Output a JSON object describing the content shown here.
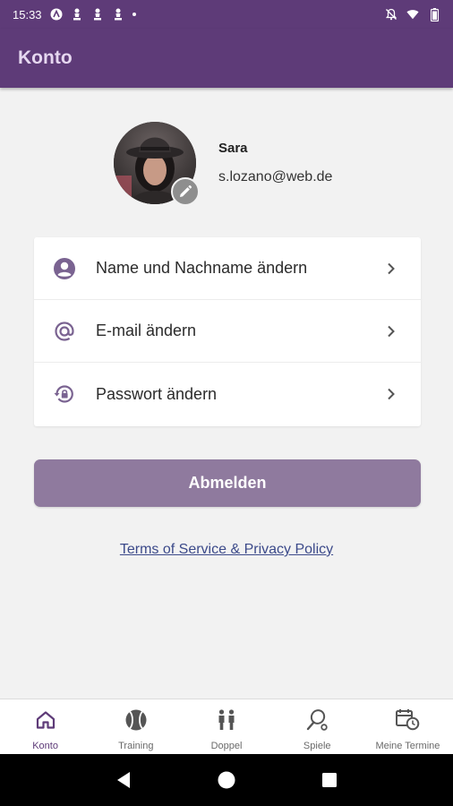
{
  "status_bar": {
    "time": "15:33",
    "icons_left": [
      "accessibility-icon",
      "chess-pawn-icon",
      "chess-pawn-icon",
      "chess-pawn-icon",
      "dot"
    ],
    "icons_right": [
      "notifications-off-icon",
      "wifi-icon",
      "battery-icon"
    ]
  },
  "app_bar": {
    "title": "Konto"
  },
  "profile": {
    "name": "Sara",
    "email": "s.lozano@web.de",
    "edit_icon": "pencil-icon"
  },
  "settings": {
    "items": [
      {
        "label": "Name und Nachname ändern",
        "icon": "account-circle-icon"
      },
      {
        "label": "E-mail ändern",
        "icon": "at-sign-icon"
      },
      {
        "label": "Passwort ändern",
        "icon": "lock-reset-icon"
      }
    ]
  },
  "logout": {
    "label": "Abmelden"
  },
  "terms": {
    "label": "Terms of Service & Privacy Policy"
  },
  "bottom_nav": {
    "items": [
      {
        "label": "Konto",
        "icon": "home-icon",
        "active": true
      },
      {
        "label": "Training",
        "icon": "tennis-ball-icon",
        "active": false
      },
      {
        "label": "Doppel",
        "icon": "people-icon",
        "active": false
      },
      {
        "label": "Spiele",
        "icon": "racket-icon",
        "active": false
      },
      {
        "label": "Meine Termine",
        "icon": "calendar-clock-icon",
        "active": false
      }
    ]
  },
  "colors": {
    "primary": "#5e3b78",
    "app_title": "#e6d7f0",
    "logout_button": "#8f7a9e",
    "link": "#3c4a8a",
    "icon": "#7a6391"
  }
}
